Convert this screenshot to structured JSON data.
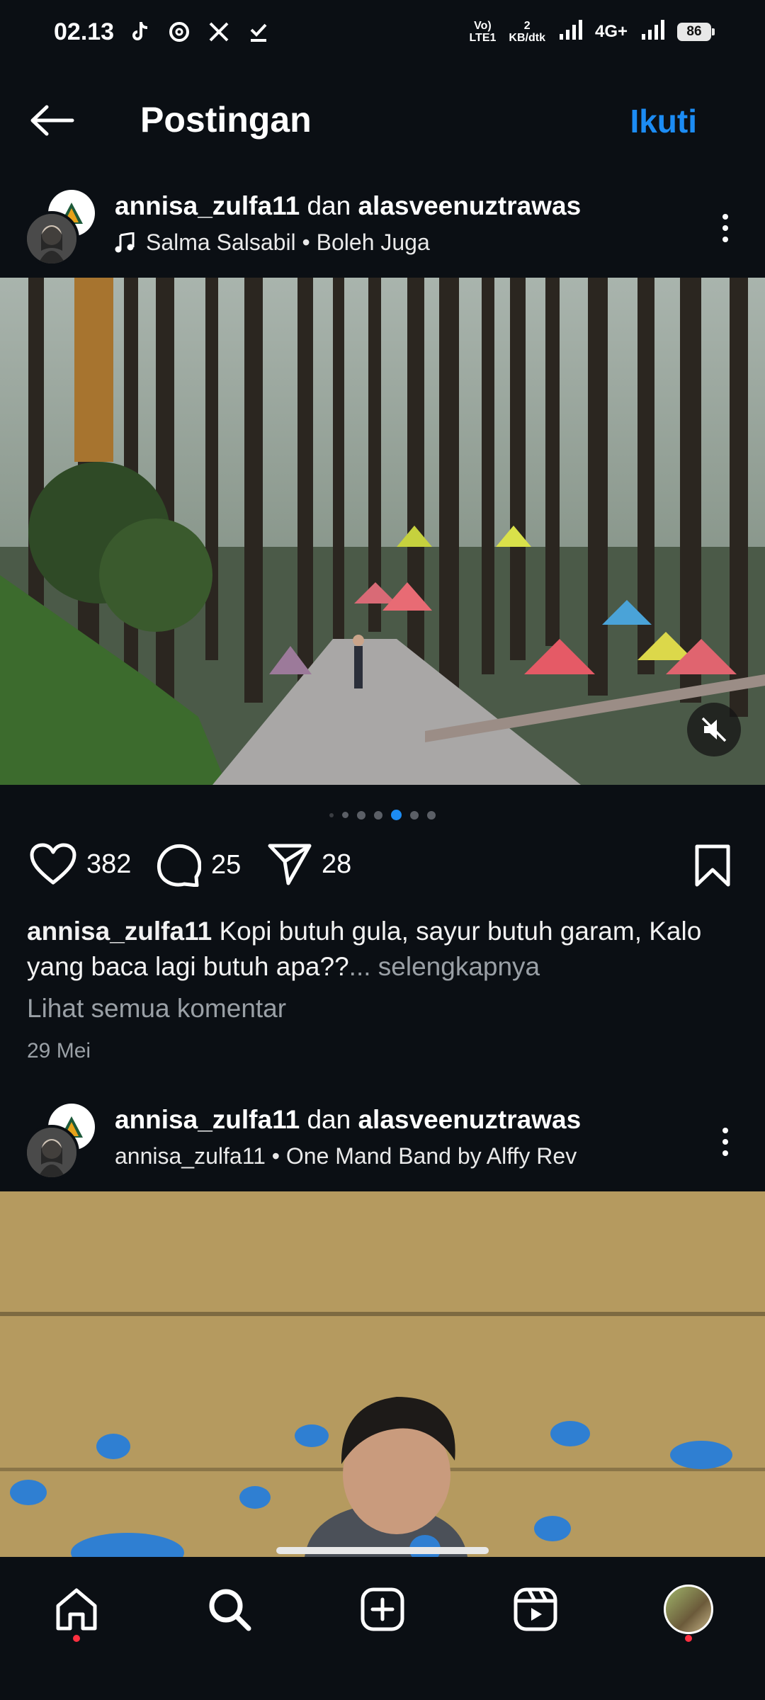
{
  "status_bar": {
    "time": "02.13",
    "network_top": "Vo)",
    "network_bottom": "LTE1",
    "speed_value": "2",
    "speed_unit": "KB/dtk",
    "network_type": "4G+",
    "battery": "86"
  },
  "header": {
    "title": "Postingan",
    "follow_label": "Ikuti"
  },
  "post1": {
    "user1": "annisa_zulfa11",
    "joiner": "dan",
    "user2": "alasveenuztrawas",
    "audio": "Salma Salsabil • Boleh Juga",
    "likes": "382",
    "comments": "25",
    "shares": "28",
    "caption_user": "annisa_zulfa11",
    "caption_text": "Kopi butuh gula, sayur butuh garam, Kalo yang baca lagi butuh apa??",
    "caption_more": "... selengkapnya",
    "view_comments": "Lihat semua komentar",
    "date": "29 Mei",
    "carousel_count": 6,
    "carousel_active": 4
  },
  "post2": {
    "user1": "annisa_zulfa11",
    "joiner": "dan",
    "user2": "alasveenuztrawas",
    "audio": "annisa_zulfa11 • One Mand Band by Alffy Rev"
  },
  "nav": {
    "icons": [
      "home-icon",
      "search-icon",
      "create-icon",
      "reels-icon",
      "profile-avatar"
    ]
  },
  "colors": {
    "background": "#0b0f14",
    "accent": "#1c8cf4",
    "notification": "#ff3040"
  }
}
